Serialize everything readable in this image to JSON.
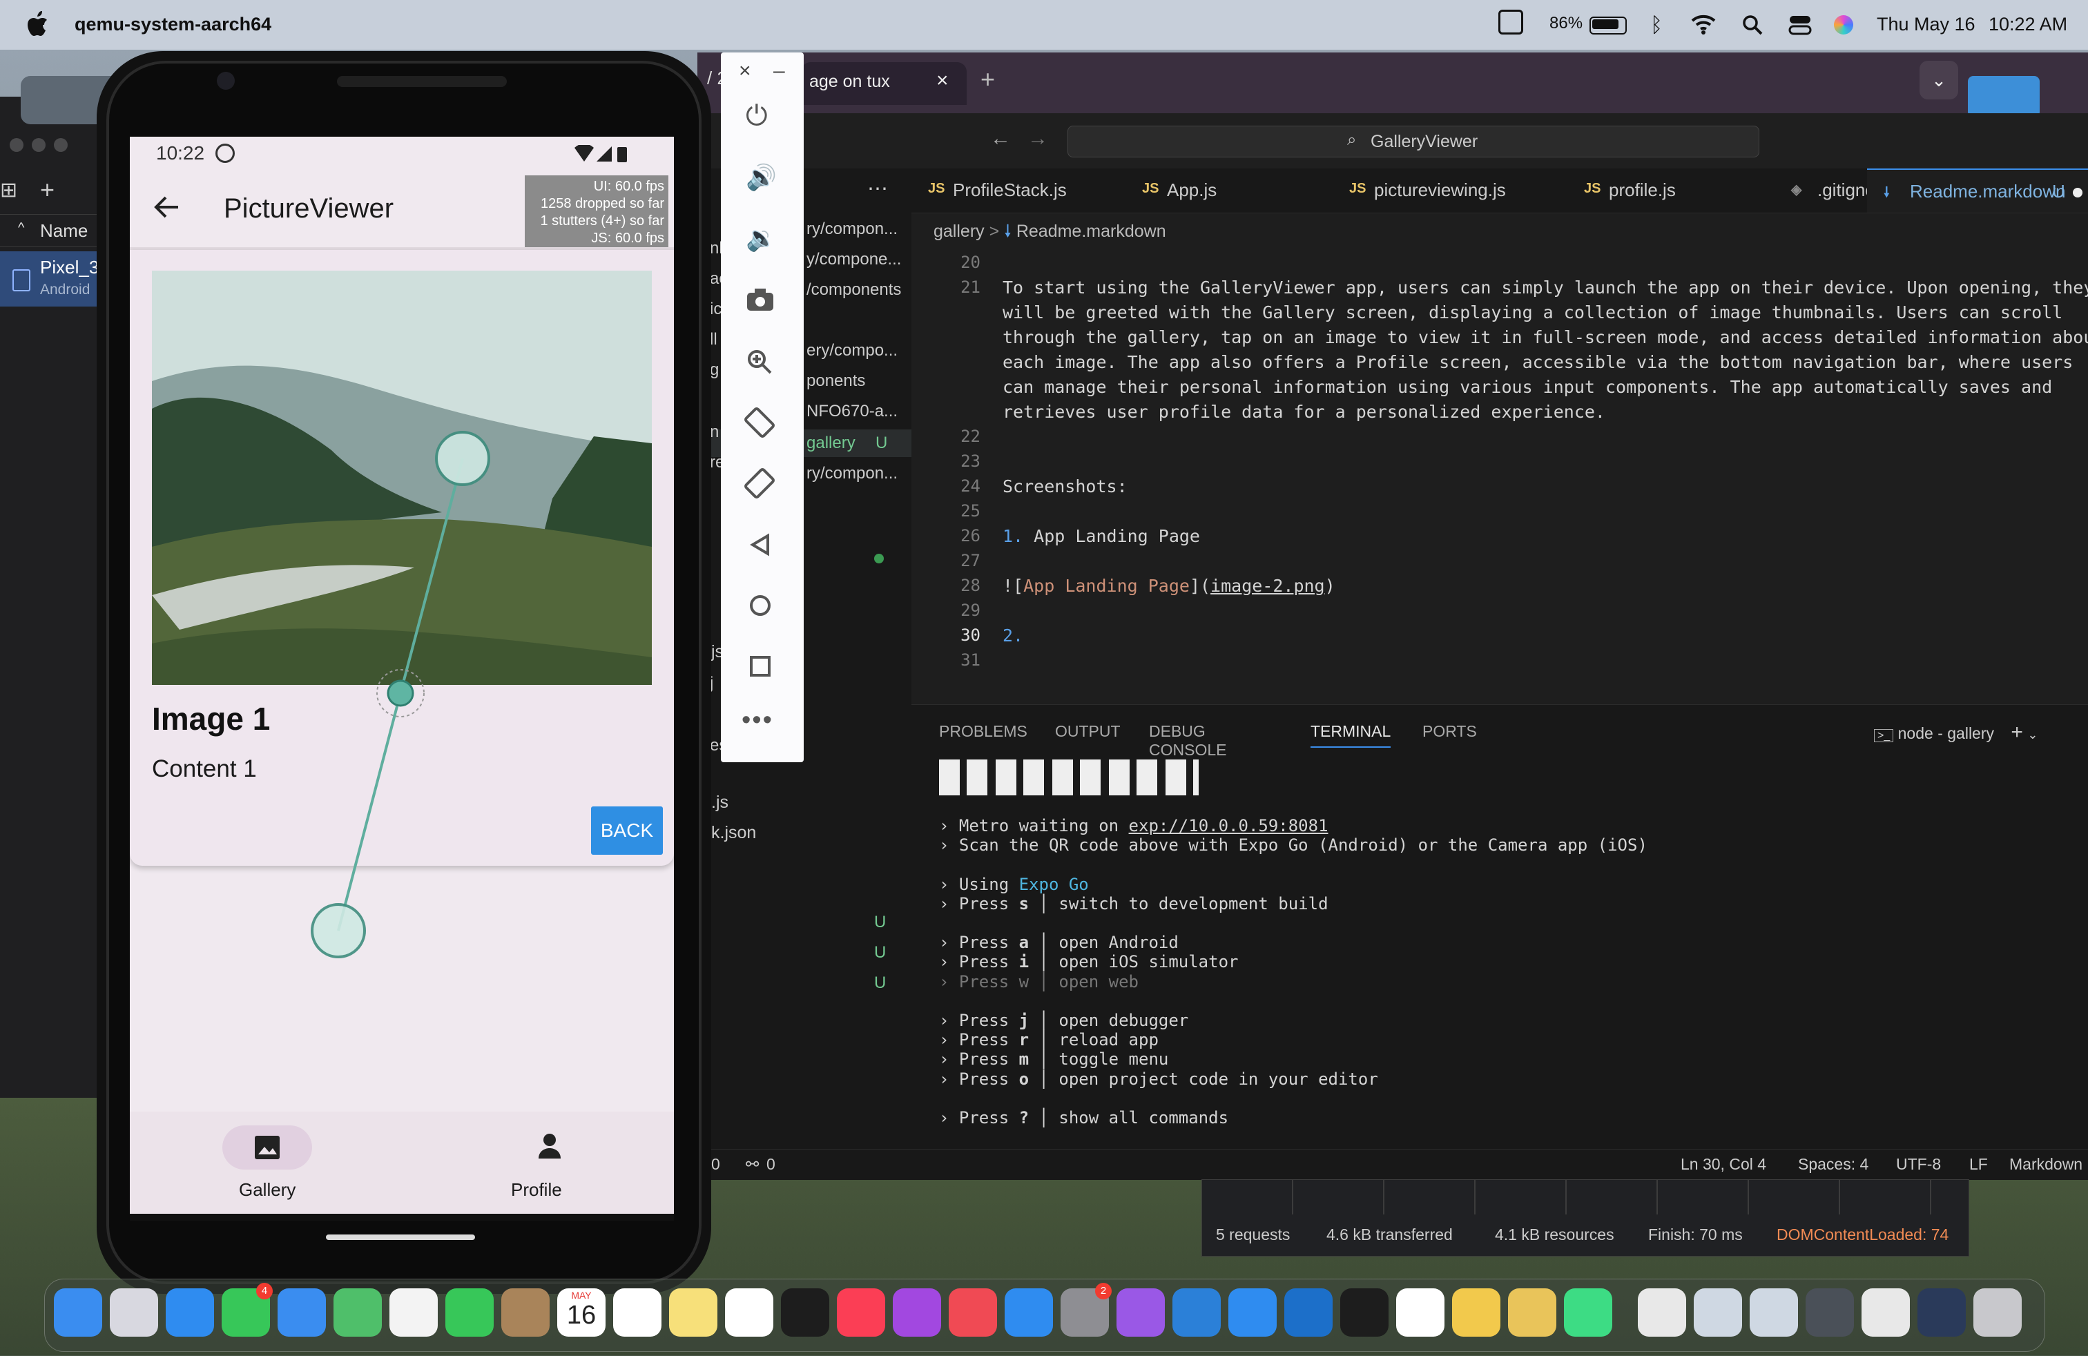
{
  "menubar": {
    "app_name": "qemu-system-aarch64",
    "battery": "86%",
    "date": "Thu May 16",
    "time": "10:22 AM"
  },
  "left_panel": {
    "header": "Name",
    "item": "Pixel_3",
    "sub": "Android"
  },
  "browser": {
    "tab_title": "age on tux",
    "tab_prefix": "/ 2"
  },
  "vscode": {
    "search": "GalleryViewer",
    "tabs": [
      "ProfileStack.js",
      "App.js",
      "pictureviewing.js",
      "profile.js",
      ".gitignore",
      "Readme.markdown"
    ],
    "active_tab_badge": "U",
    "breadcrumb": [
      "gallery",
      "Readme.markdown"
    ],
    "explorer": [
      "ry/compon...",
      "y/compone...",
      "/components",
      "ery/compo...",
      "ponents",
      "NFO670-a...",
      "gallery",
      "ry/compon..."
    ],
    "explorer_badge": "U",
    "explorer_files": [
      "js",
      ".js",
      "k.json"
    ],
    "explorer_frag": [
      "nl",
      "ac",
      "ic",
      "ll",
      "g",
      "n",
      "re",
      "j",
      "es"
    ],
    "explorer_u": [
      "U",
      "U",
      "U"
    ],
    "lines": [
      {
        "n": "20",
        "t": ""
      },
      {
        "n": "21",
        "t": "To start using the GalleryViewer app, users can simply launch the app on their device. Upon opening, they"
      },
      {
        "n": "",
        "t": "will be greeted with the Gallery screen, displaying a collection of image thumbnails. Users can scroll"
      },
      {
        "n": "",
        "t": "through the gallery, tap on an image to view it in full-screen mode, and access detailed information about"
      },
      {
        "n": "",
        "t": "each image. The app also offers a Profile screen, accessible via the bottom navigation bar, where users"
      },
      {
        "n": "",
        "t": "can manage their personal information using various input components. The app automatically saves and"
      },
      {
        "n": "",
        "t": "retrieves user profile data for a personalized experience."
      },
      {
        "n": "22",
        "t": ""
      },
      {
        "n": "23",
        "t": ""
      },
      {
        "n": "24",
        "t": "Screenshots:"
      },
      {
        "n": "25",
        "t": ""
      },
      {
        "n": "26",
        "t": "App Landing Page",
        "pre": "1. "
      },
      {
        "n": "27",
        "t": ""
      },
      {
        "n": "28",
        "t": "",
        "md": true
      },
      {
        "n": "29",
        "t": ""
      },
      {
        "n": "30",
        "t": "",
        "pre": "2."
      },
      {
        "n": "31",
        "t": ""
      }
    ],
    "md_line": {
      "open": "![",
      "text": "App Landing Page",
      "mid": "](",
      "link": "image-2.png",
      "close": ")"
    },
    "panel_tabs": [
      "PROBLEMS",
      "OUTPUT",
      "DEBUG CONSOLE",
      "TERMINAL",
      "PORTS"
    ],
    "terminal_label": "node - gallery",
    "terminal": [
      {
        "a": "› Metro waiting on ",
        "u": "exp://10.0.0.59:8081"
      },
      {
        "a": "› Scan the QR code above with Expo Go (Android) or the Camera app (iOS)"
      },
      {
        "a": ""
      },
      {
        "a": "› Using ",
        "c": "Expo Go"
      },
      {
        "a": "› Press ",
        "k": "s",
        "b": " │ switch to development build"
      },
      {
        "a": ""
      },
      {
        "a": "› Press ",
        "k": "a",
        "b": " │ open Android"
      },
      {
        "a": "› Press ",
        "k": "i",
        "b": " │ open iOS simulator"
      },
      {
        "a": "› Press w │ open web",
        "dim": true
      },
      {
        "a": ""
      },
      {
        "a": "› Press ",
        "k": "j",
        "b": " │ open debugger"
      },
      {
        "a": "› Press ",
        "k": "r",
        "b": " │ reload app"
      },
      {
        "a": "› Press ",
        "k": "m",
        "b": " │ toggle menu"
      },
      {
        "a": "› Press ",
        "k": "o",
        "b": " │ open project code in your editor"
      },
      {
        "a": ""
      },
      {
        "a": "› Press ",
        "k": "?",
        "b": " │ show all commands"
      }
    ],
    "status": {
      "left1": "0",
      "left2": "0",
      "pos": "Ln 30, Col 4",
      "spaces": "Spaces: 4",
      "enc": "UTF-8",
      "eol": "LF",
      "lang": "Markdown"
    }
  },
  "devtools": {
    "requests": "5 requests",
    "transferred": "4.6 kB transferred",
    "resources": "4.1 kB resources",
    "finish": "Finish: 70 ms",
    "dom": "DOMContentLoaded: 74"
  },
  "phone": {
    "time": "10:22",
    "title": "PictureViewer",
    "perf": [
      "UI: 60.0 fps",
      "1258 dropped so far",
      "1 stutters (4+) so far",
      "JS: 60.0 fps"
    ],
    "card_title": "Image 1",
    "card_content": "Content 1",
    "back": "BACK",
    "nav": [
      {
        "label": "Gallery",
        "icon": "image-icon"
      },
      {
        "label": "Profile",
        "icon": "person-icon"
      }
    ]
  },
  "dock": {
    "calendar_month": "MAY",
    "calendar_day": "16",
    "messages_badge": "4",
    "settings_badge": "2"
  }
}
